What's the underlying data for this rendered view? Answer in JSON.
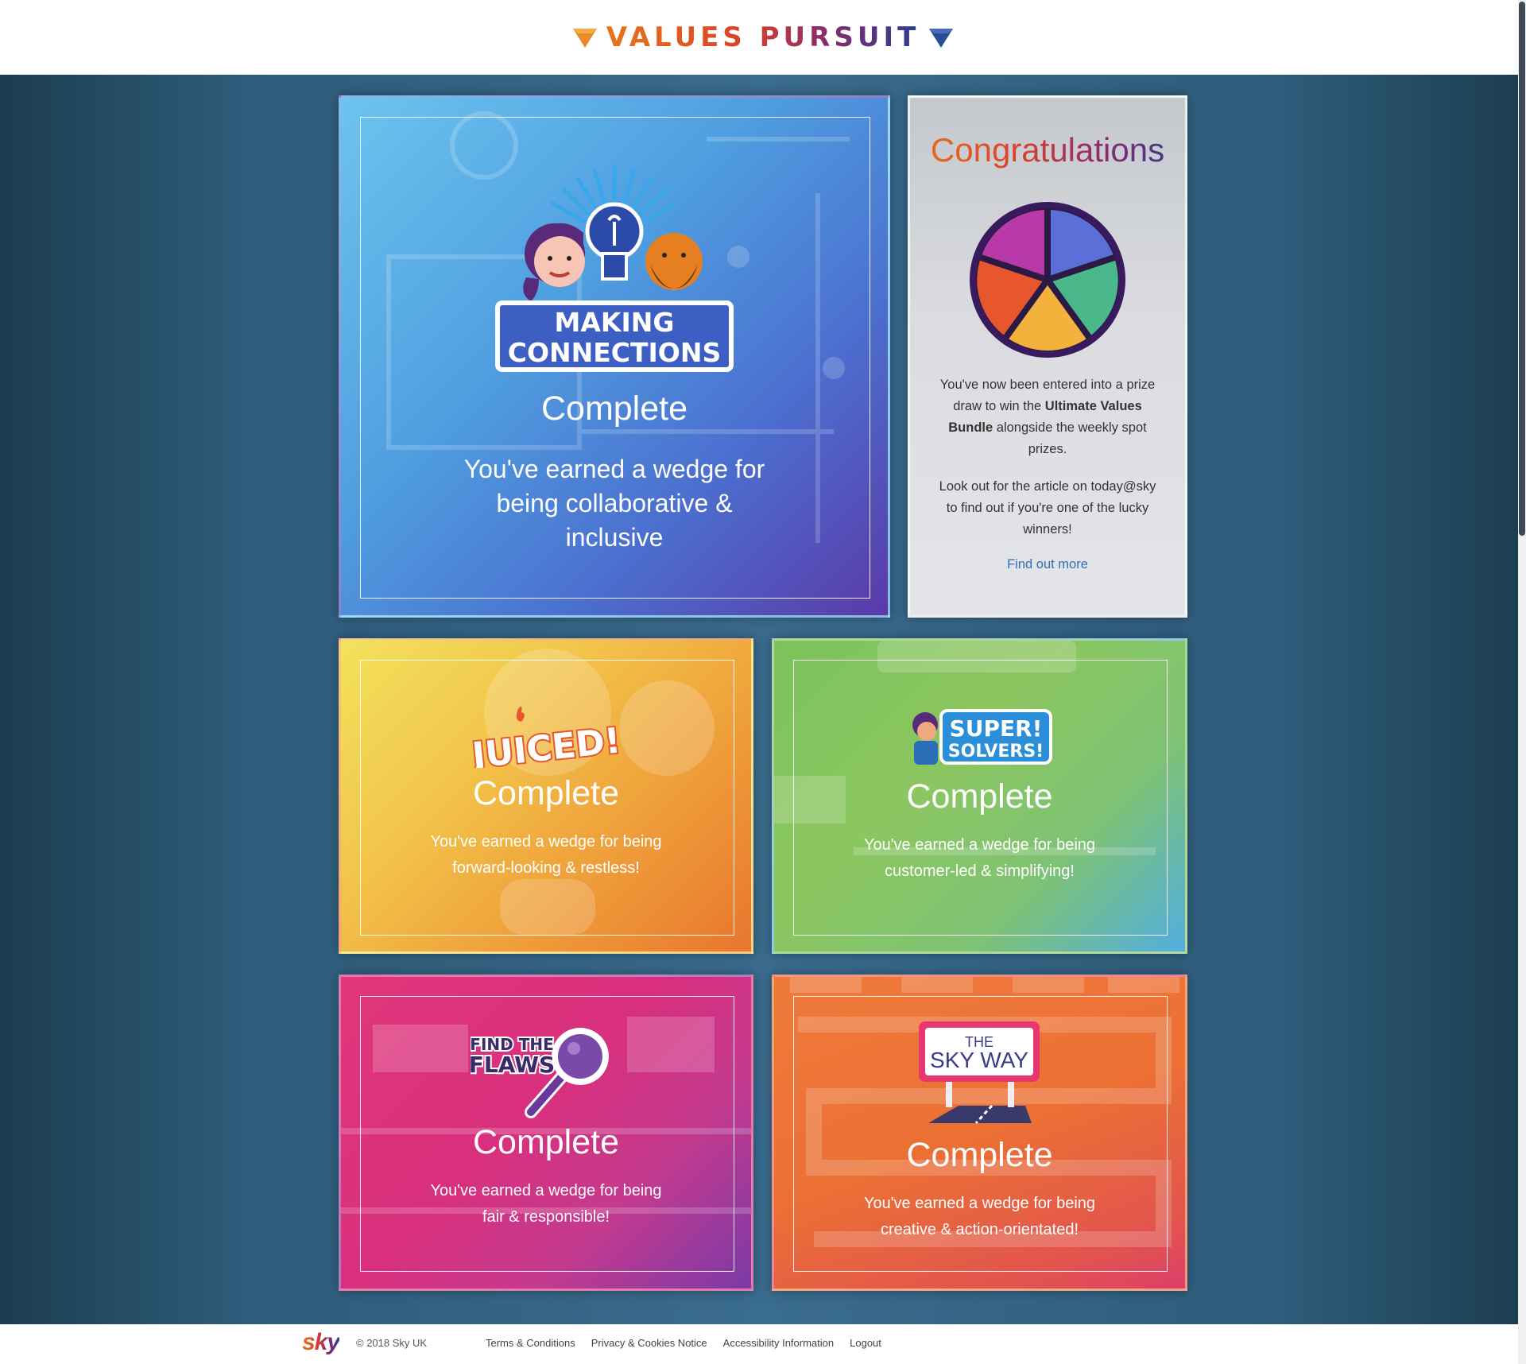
{
  "header": {
    "logo_text": "VALUES PURSUIT"
  },
  "cards": {
    "making_connections": {
      "logo_line1": "MAKING",
      "logo_line2": "CONNECTIONS",
      "status": "Complete",
      "message": "You've earned a wedge for being collaborative & inclusive",
      "accent": "#4b6fcf"
    },
    "juiced": {
      "logo": "JUICED!",
      "status": "Complete",
      "message": "You've earned a wedge for being forward-looking & restless!",
      "accent": "#f2c44a"
    },
    "super_solvers": {
      "logo_line1": "SUPER!",
      "logo_line2": "SOLVERS!",
      "status": "Complete",
      "message": "You've earned a wedge for being customer-led & simplifying!",
      "accent": "#7cc25c"
    },
    "find_the_flaws": {
      "logo_line1": "FIND THE",
      "logo_line2": "FLAWS",
      "status": "Complete",
      "message": "You've earned a wedge for being fair & responsible!",
      "accent": "#d8307e"
    },
    "sky_way": {
      "logo_line1": "THE",
      "logo_line2": "SKY WAY",
      "status": "Complete",
      "message": "You've earned a wedge for being creative & action-orientated!",
      "accent": "#ec7034"
    }
  },
  "congrats": {
    "title": "Congratulations",
    "para1_before": "You've now been entered into a prize draw to win the ",
    "para1_bold": "Ultimate Values Bundle",
    "para1_after": " alongside the weekly spot prizes.",
    "para2": "Look out for the article on today@sky to find out if you're one of the lucky winners!",
    "link": "Find out more",
    "link_color": "#2f6fb8"
  },
  "footer": {
    "logo": "sky",
    "copyright": "© 2018 Sky UK",
    "links": [
      "Terms & Conditions",
      "Privacy & Cookies Notice",
      "Accessibility Information",
      "Logout"
    ]
  }
}
